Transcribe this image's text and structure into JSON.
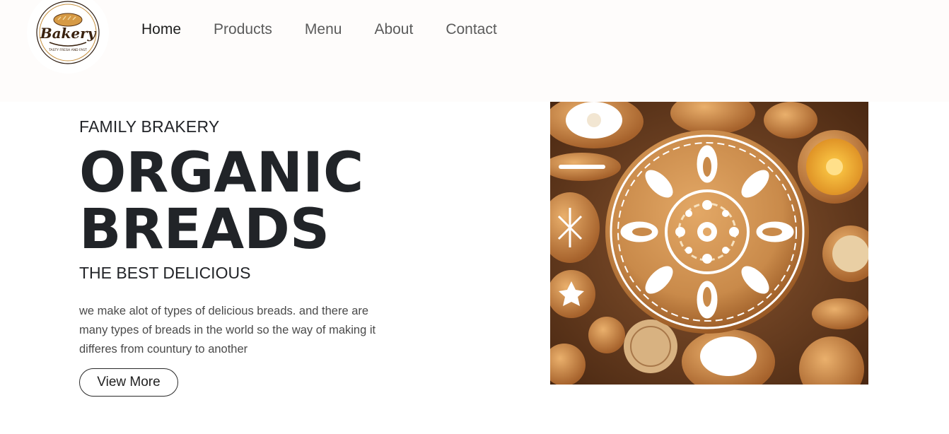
{
  "header": {
    "logo": {
      "text": "Bakery",
      "tagline": "TASTY FRESH AND FAST",
      "icon": "bread-logo-icon"
    },
    "nav": [
      {
        "label": "Home",
        "active": true
      },
      {
        "label": "Products",
        "active": false
      },
      {
        "label": "Menu",
        "active": false
      },
      {
        "label": "About",
        "active": false
      },
      {
        "label": "Contact",
        "active": false
      }
    ]
  },
  "hero": {
    "eyebrow": "FAMILY BRAKERY",
    "headline_line1": "ORGANIC",
    "headline_line2": "BREADS",
    "subhead": "THE BEST DELICIOUS",
    "description": "we make alot of types of delicious breads. and there are many types of breads in the world so the way of making it differes from countury to another",
    "button_label": "View More",
    "image_icon": "decorated-bread-image"
  },
  "colors": {
    "header_bg": "#fefcfb",
    "heading_text": "#212428",
    "nav_text": "#5b5b5b",
    "bread_crust": "#c98a4a",
    "icing": "#ffffff",
    "wood": "#6b3f22"
  }
}
